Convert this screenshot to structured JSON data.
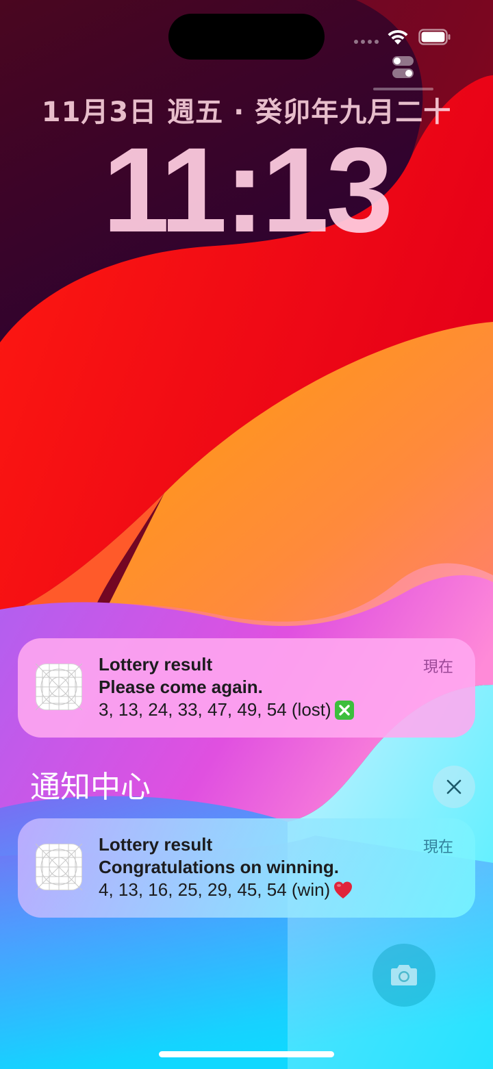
{
  "lock_screen": {
    "date": "11月3日 週五 · 癸卯年九月二十",
    "time": "11:13"
  },
  "status_bar": {
    "icons": [
      "cellular-signal-icon",
      "wifi-icon",
      "battery-icon"
    ]
  },
  "notification_center": {
    "title": "通知中心",
    "clear_icon": "close-icon"
  },
  "notifications": [
    {
      "app_icon": "placeholder-app-icon",
      "title": "Lottery result",
      "subtitle": "Please come again.",
      "body": "3, 13, 24, 33, 47, 49, 54 (lost)",
      "status_icon": "cross-mark-icon",
      "time": "現在",
      "background": "#FFA8F0"
    },
    {
      "app_icon": "placeholder-app-icon",
      "title": "Lottery result",
      "subtitle": "Congratulations on winning.",
      "body": "4, 13, 16, 25, 29, 45, 54 (win)",
      "status_icon": "red-heart-icon",
      "time": "現在",
      "background": "#A8E8FF"
    }
  ],
  "quick_actions": {
    "camera_icon": "camera-icon"
  },
  "colors": {
    "cross_mark_green": "#3DBE3D",
    "heart_red": "#E0243A"
  }
}
